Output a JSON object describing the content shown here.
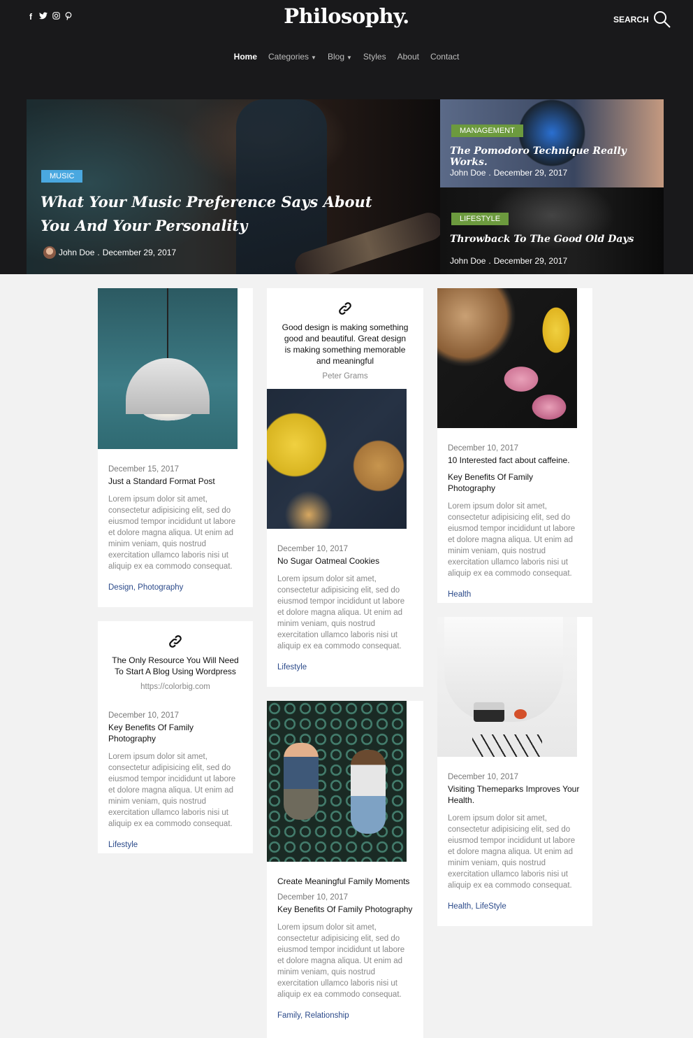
{
  "header": {
    "logo": "Philosophy.",
    "search_label": "SEARCH",
    "social_icons": [
      "facebook-icon",
      "twitter-icon",
      "instagram-icon",
      "pinterest-icon"
    ],
    "nav": [
      {
        "label": "Home",
        "active": true
      },
      {
        "label": "Categories",
        "dropdown": true
      },
      {
        "label": "Blog",
        "dropdown": true
      },
      {
        "label": "Styles"
      },
      {
        "label": "About"
      },
      {
        "label": "Contact"
      }
    ]
  },
  "featured": {
    "main": {
      "category": "MUSIC",
      "title": "What Your Music Preference Says About You And Your Personality",
      "author": "John Doe",
      "date": "December 29, 2017"
    },
    "side": [
      {
        "category": "MANAGEMENT",
        "title": "The Pomodoro Technique Really Works.",
        "author": "John Doe",
        "date": "December 29, 2017"
      },
      {
        "category": "LIFESTYLE",
        "title": "Throwback To The Good Old Days",
        "author": "John Doe",
        "date": "December 29, 2017"
      }
    ]
  },
  "posts": {
    "lamp": {
      "date": "December 15, 2017",
      "title": "Just a Standard Format Post",
      "excerpt": "Lorem ipsum dolor sit amet, consectetur adipisicing elit, sed do eiusmod tempor incididunt ut labore et dolore magna aliqua. Ut enim ad minim veniam, quis nostrud exercitation ullamco laboris nisi ut aliquip ex ea commodo consequat.",
      "tags": "Design, Photography"
    },
    "link1": {
      "text": "The Only Resource You Will Need To Start A Blog Using Wordpress",
      "url": "https://colorbig.com",
      "date": "December 10, 2017",
      "title": "Key Benefits Of Family Photography",
      "excerpt": "Lorem ipsum dolor sit amet, consectetur adipisicing elit, sed do eiusmod tempor incididunt ut labore et dolore magna aliqua. Ut enim ad minim veniam, quis nostrud exercitation ullamco laboris nisi ut aliquip ex ea commodo consequat.",
      "tags": "Lifestyle"
    },
    "quote": {
      "text": "Good design is making something good and beautiful. Great design is making something memorable and meaningful",
      "author": "Peter Grams"
    },
    "cookies": {
      "date": "December 10, 2017",
      "title": "No Sugar Oatmeal Cookies",
      "excerpt": "Lorem ipsum dolor sit amet, consectetur adipisicing elit, sed do eiusmod tempor incididunt ut labore et dolore magna aliqua. Ut enim ad minim veniam, quis nostrud exercitation ullamco laboris nisi ut aliquip ex ea commodo consequat.",
      "tags": "Lifestyle"
    },
    "family": {
      "caption": "Create Meaningful Family Moments",
      "date": "December 10, 2017",
      "title": "Key Benefits Of Family Photography",
      "excerpt": "Lorem ipsum dolor sit amet, consectetur adipisicing elit, sed do eiusmod tempor incididunt ut labore et dolore magna aliqua. Ut enim ad minim veniam, quis nostrud exercitation ullamco laboris nisi ut aliquip ex ea commodo consequat.",
      "tags": "Family, Relationship"
    },
    "coffee": {
      "date": "December 10, 2017",
      "subtitle": "10 Interested fact about caffeine.",
      "title": "Key Benefits Of Family Photography",
      "excerpt": "Lorem ipsum dolor sit amet, consectetur adipisicing elit, sed do eiusmod tempor incididunt ut labore et dolore magna aliqua. Ut enim ad minim veniam, quis nostrud exercitation ullamco laboris nisi ut aliquip ex ea commodo consequat.",
      "tags": "Health"
    },
    "chair": {
      "date": "December 10, 2017",
      "title": "Visiting Themeparks Improves Your Health.",
      "excerpt": "Lorem ipsum dolor sit amet, consectetur adipisicing elit, sed do eiusmod tempor incididunt ut labore et dolore magna aliqua. Ut enim ad minim veniam, quis nostrud exercitation ullamco laboris nisi ut aliquip ex ea commodo consequat.",
      "tags": "Health, LifeStyle"
    }
  },
  "colors": {
    "header_bg": "#19191b",
    "music": "#4aa8e0",
    "green": "#6c9a3e",
    "link": "#2b4a8a"
  }
}
